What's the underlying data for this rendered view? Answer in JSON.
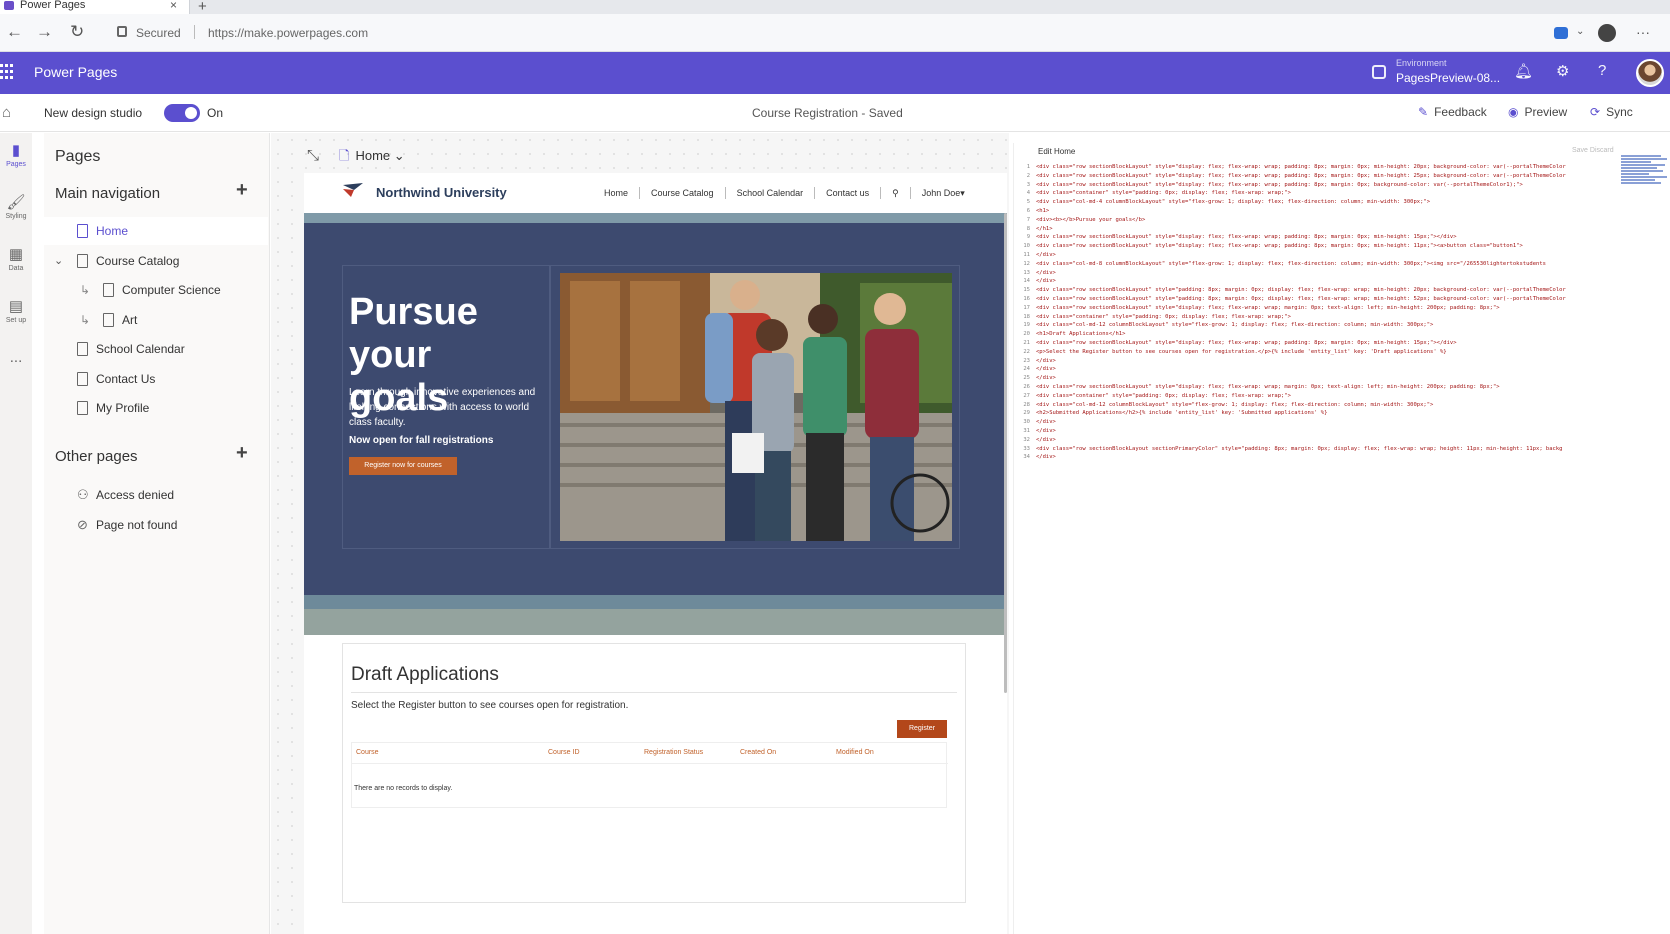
{
  "browser": {
    "tab_title": "Power Pages",
    "secured_label": "Secured",
    "url": "https://make.powerpages.com"
  },
  "app": {
    "title": "Power Pages",
    "environment_label": "Environment",
    "environment_name": "PagesPreview-08..."
  },
  "command_bar": {
    "design_studio_label": "New design studio",
    "toggle_state": "On",
    "document_title": "Course Registration - Saved",
    "feedback": "Feedback",
    "preview": "Preview",
    "sync": "Sync"
  },
  "rail": {
    "items": [
      {
        "label": "Pages",
        "icon": "pages-icon"
      },
      {
        "label": "Styling",
        "icon": "styling-icon"
      },
      {
        "label": "Data",
        "icon": "data-icon"
      },
      {
        "label": "Set up",
        "icon": "setup-icon"
      },
      {
        "label": "...",
        "icon": "more-icon"
      }
    ]
  },
  "pages_panel": {
    "title": "Pages",
    "main_nav_title": "Main navigation",
    "main_nav": [
      {
        "label": "Home"
      },
      {
        "label": "Course Catalog"
      },
      {
        "label": "Computer Science"
      },
      {
        "label": "Art"
      },
      {
        "label": "School Calendar"
      },
      {
        "label": "Contact Us"
      },
      {
        "label": "My Profile"
      }
    ],
    "other_pages_title": "Other pages",
    "other_pages": [
      {
        "label": "Access denied"
      },
      {
        "label": "Page not found"
      }
    ]
  },
  "canvas": {
    "page_selector": "Home"
  },
  "site": {
    "name": "Northwind University",
    "nav": [
      "Home",
      "Course Catalog",
      "School Calendar",
      "Contact us",
      "John Doe"
    ],
    "hero_title": "Pursue your goals",
    "hero_text": "Learn through innovative experiences and lifelong connections with access to world class faculty.",
    "hero_open": "Now open for fall registrations",
    "hero_button": "Register now for courses",
    "draft_title": "Draft Applications",
    "draft_desc": "Select the Register button to see courses open for registration.",
    "register_button": "Register",
    "grid_columns": [
      "Course",
      "Course ID",
      "Registration Status",
      "Created On",
      "Modified On"
    ],
    "grid_empty": "There are no records to display."
  },
  "code_editor": {
    "title": "Edit Home",
    "actions": "Save   Discard",
    "lines": [
      "<div class=\"row sectionBlockLayout\" style=\"display: flex; flex-wrap: wrap; padding: 8px; margin: 0px; min-height: 20px; background-color: var(--portalThemeColor",
      "<div class=\"row sectionBlockLayout\" style=\"display: flex; flex-wrap: wrap; padding: 8px; margin: 0px; min-height: 25px; background-color: var(--portalThemeColor",
      "<div class=\"row sectionBlockLayout\" style=\"display: flex; flex-wrap: wrap; padding: 8px; margin: 0px; background-color: var(--portalThemeColor1);\">",
      "  <div class=\"container\" style=\"padding: 0px; display: flex; flex-wrap: wrap;\">",
      "    <div class=\"col-md-4 columnBlockLayout\" style=\"flex-grow: 1; display: flex; flex-direction: column; min-width: 300px;\">",
      "      <h1>",
      "        <div><b></b>Pursue your goals</b>",
      "      </h1>",
      "      <div class=\"row sectionBlockLayout\" style=\"display: flex; flex-wrap: wrap; padding: 8px; margin: 0px; min-height: 15px;\"></div>",
      "      <div class=\"row sectionBlockLayout\" style=\"display: flex; flex-wrap: wrap; padding: 8px; margin: 0px; min-height: 11px;\"><a>button class=\"button1\">",
      "    </div>",
      "    <div class=\"col-md-8 columnBlockLayout\" style=\"flex-grow: 1; display: flex; flex-direction: column; min-width: 300px;\"><img src=\"/265530lightertokstudents",
      "  </div>",
      "</div>",
      "<div class=\"row sectionBlockLayout\" style=\"padding: 8px; margin: 0px; display: flex; flex-wrap: wrap; min-height: 20px; background-color: var(--portalThemeColor",
      "<div class=\"row sectionBlockLayout\" style=\"padding: 8px; margin: 0px; display: flex; flex-wrap: wrap; min-height: 52px; background-color: var(--portalThemeColor",
      "<div class=\"row sectionBlockLayout\" style=\"display: flex; flex-wrap: wrap; margin: 0px; text-align: left; min-height: 200px; padding: 8px;\">",
      "  <div class=\"container\" style=\"padding: 0px; display: flex; flex-wrap: wrap;\">",
      "    <div class=\"col-md-12 columnBlockLayout\" style=\"flex-grow: 1; display: flex; flex-direction: column; min-width: 300px;\">",
      "      <h1>Draft Applications</h1>",
      "      <div class=\"row sectionBlockLayout\" style=\"display: flex; flex-wrap: wrap; padding: 8px; margin: 0px; min-height: 15px;\"></div>",
      "      <p>Select the Register button to see courses open for registration.</p>{% include 'entity_list' key: 'Draft applications' %}",
      "    </div>",
      "  </div>",
      "</div>",
      "<div class=\"row sectionBlockLayout\" style=\"display: flex; flex-wrap: wrap; margin: 0px; text-align: left; min-height: 200px; padding: 8px;\">",
      "  <div class=\"container\" style=\"padding: 0px; display: flex; flex-wrap: wrap;\">",
      "    <div class=\"col-md-12 columnBlockLayout\" style=\"flex-grow: 1; display: flex; flex-direction: column; min-width: 300px;\">",
      "      <h2>Submitted Applications</h2>{% include 'entity_list' key: 'Submitted applications' %}",
      "    </div>",
      "  </div>",
      "</div>",
      "<div class=\"row sectionBlockLayout sectionPrimaryColor\" style=\"padding: 8px; margin: 0px; display: flex; flex-wrap: wrap; height: 11px; min-height: 11px; backg",
      "</div>"
    ]
  },
  "colors": {
    "brand_purple": "#5b4fcf",
    "hero_navy": "#3d4a6f",
    "accent_orange": "#c1622b"
  }
}
